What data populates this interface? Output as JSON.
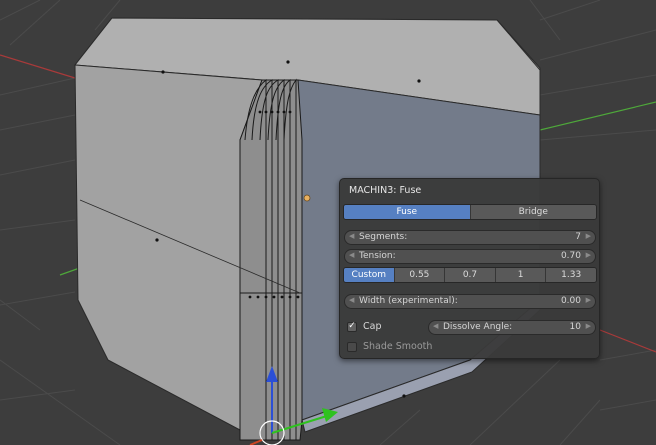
{
  "panel": {
    "title": "MACHIN3: Fuse",
    "method_tabs": [
      {
        "label": "Fuse",
        "active": true
      },
      {
        "label": "Bridge",
        "active": false
      }
    ],
    "segments": {
      "label": "Segments:",
      "value": "7"
    },
    "tension": {
      "label": "Tension:",
      "value": "0.70"
    },
    "tension_presets": [
      {
        "label": "Custom",
        "active": true
      },
      {
        "label": "0.55",
        "active": false
      },
      {
        "label": "0.7",
        "active": false
      },
      {
        "label": "1",
        "active": false
      },
      {
        "label": "1.33",
        "active": false
      }
    ],
    "width": {
      "label": "Width (experimental):",
      "value": "0.00"
    },
    "cap": {
      "label": "Cap",
      "checked": true
    },
    "dissolve_angle": {
      "label": "Dissolve Angle:",
      "value": "10"
    },
    "shade_smooth": {
      "label": "Shade Smooth",
      "checked": false
    }
  },
  "icons": {
    "num_decrement": "chevron-left-icon",
    "num_increment": "chevron-right-icon",
    "checkmark": "check-icon"
  },
  "colors": {
    "accent": "#5680c2",
    "background": "#3d3d3d",
    "panel": "#3a3a3a",
    "x_axis": "#c83c3c",
    "y_axis": "#5ac83c"
  }
}
